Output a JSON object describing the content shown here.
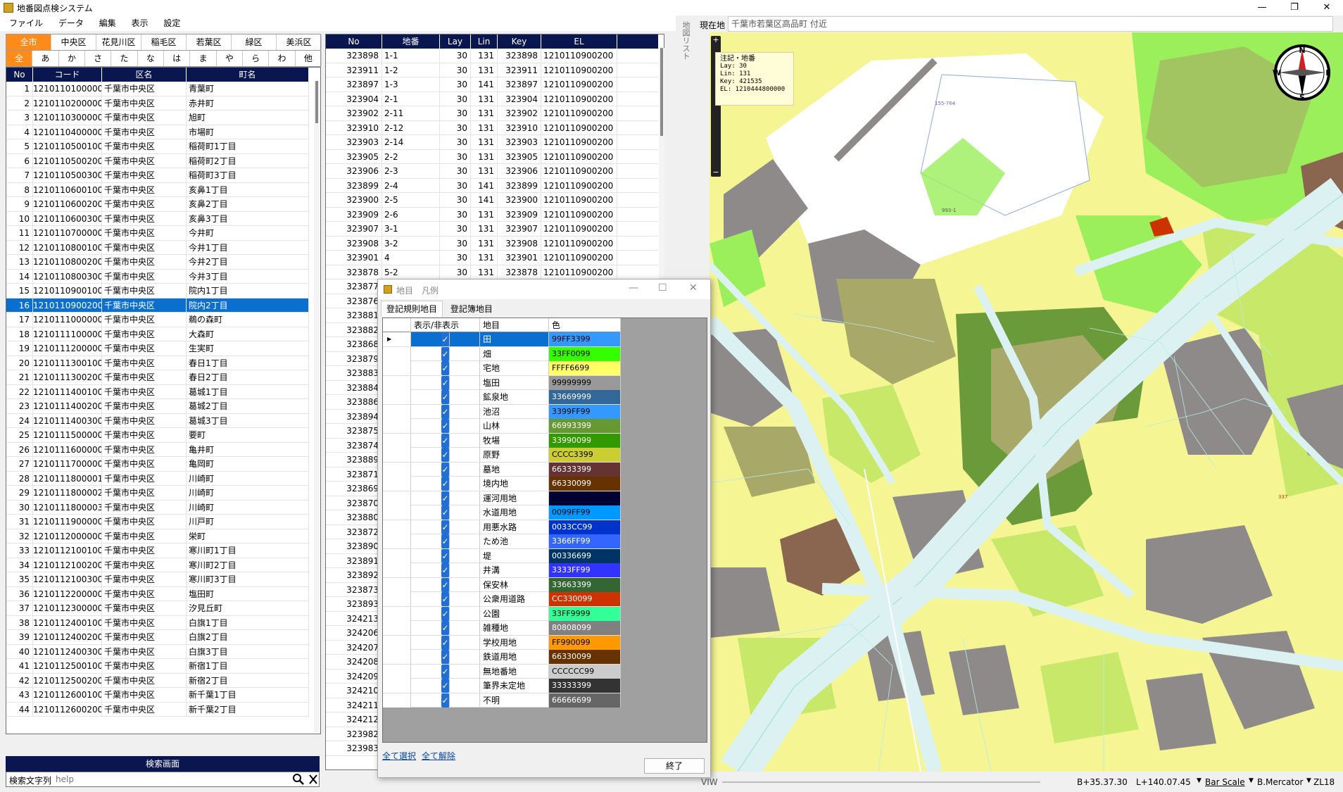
{
  "window": {
    "title": "地番図点検システム",
    "controls": [
      "—",
      "❐",
      "✕"
    ]
  },
  "menu": [
    "ファイル",
    "データ",
    "編集",
    "表示",
    "設定"
  ],
  "ward_tabs": [
    "全市",
    "中央区",
    "花見川区",
    "稲毛区",
    "若葉区",
    "緑区",
    "美浜区"
  ],
  "kana_tabs": [
    "全",
    "あ",
    "か",
    "さ",
    "た",
    "な",
    "は",
    "ま",
    "や",
    "ら",
    "わ",
    "他"
  ],
  "town_table": {
    "columns": [
      "No",
      "コード",
      "区名",
      "町名"
    ],
    "selected_no": "16",
    "rows": [
      [
        "1",
        "1210110100000",
        "千葉市中央区",
        "青葉町"
      ],
      [
        "2",
        "1210110200000",
        "千葉市中央区",
        "赤井町"
      ],
      [
        "3",
        "1210110300000",
        "千葉市中央区",
        "旭町"
      ],
      [
        "4",
        "1210110400000",
        "千葉市中央区",
        "市場町"
      ],
      [
        "5",
        "1210110500100",
        "千葉市中央区",
        "稲荷町1丁目"
      ],
      [
        "6",
        "1210110500200",
        "千葉市中央区",
        "稲荷町2丁目"
      ],
      [
        "7",
        "1210110500300",
        "千葉市中央区",
        "稲荷町3丁目"
      ],
      [
        "8",
        "1210110600100",
        "千葉市中央区",
        "亥鼻1丁目"
      ],
      [
        "9",
        "1210110600200",
        "千葉市中央区",
        "亥鼻2丁目"
      ],
      [
        "10",
        "1210110600300",
        "千葉市中央区",
        "亥鼻3丁目"
      ],
      [
        "11",
        "1210110700000",
        "千葉市中央区",
        "今井町"
      ],
      [
        "12",
        "1210110800100",
        "千葉市中央区",
        "今井1丁目"
      ],
      [
        "13",
        "1210110800200",
        "千葉市中央区",
        "今井2丁目"
      ],
      [
        "14",
        "1210110800300",
        "千葉市中央区",
        "今井3丁目"
      ],
      [
        "15",
        "1210110900100",
        "千葉市中央区",
        "院内1丁目"
      ],
      [
        "16",
        "1210110900200",
        "千葉市中央区",
        "院内2丁目"
      ],
      [
        "17",
        "1210111000000",
        "千葉市中央区",
        "鵜の森町"
      ],
      [
        "18",
        "1210111100000",
        "千葉市中央区",
        "大森町"
      ],
      [
        "19",
        "1210111200000",
        "千葉市中央区",
        "生実町"
      ],
      [
        "20",
        "1210111300100",
        "千葉市中央区",
        "春日1丁目"
      ],
      [
        "21",
        "1210111300200",
        "千葉市中央区",
        "春日2丁目"
      ],
      [
        "22",
        "1210111400100",
        "千葉市中央区",
        "葛城1丁目"
      ],
      [
        "23",
        "1210111400200",
        "千葉市中央区",
        "葛城2丁目"
      ],
      [
        "24",
        "1210111400300",
        "千葉市中央区",
        "葛城3丁目"
      ],
      [
        "25",
        "1210111500000",
        "千葉市中央区",
        "要町"
      ],
      [
        "26",
        "1210111600000",
        "千葉市中央区",
        "亀井町"
      ],
      [
        "27",
        "1210111700000",
        "千葉市中央区",
        "亀岡町"
      ],
      [
        "28",
        "1210111800001",
        "千葉市中央区",
        "川崎町"
      ],
      [
        "29",
        "1210111800002",
        "千葉市中央区",
        "川崎町"
      ],
      [
        "30",
        "1210111800003",
        "千葉市中央区",
        "川崎町"
      ],
      [
        "31",
        "1210111900000",
        "千葉市中央区",
        "川戸町"
      ],
      [
        "32",
        "1210112000000",
        "千葉市中央区",
        "栄町"
      ],
      [
        "33",
        "1210112100100",
        "千葉市中央区",
        "寒川町1丁目"
      ],
      [
        "34",
        "1210112100200",
        "千葉市中央区",
        "寒川町2丁目"
      ],
      [
        "35",
        "1210112100300",
        "千葉市中央区",
        "寒川町3丁目"
      ],
      [
        "36",
        "1210112200000",
        "千葉市中央区",
        "塩田町"
      ],
      [
        "37",
        "1210112300000",
        "千葉市中央区",
        "汐見丘町"
      ],
      [
        "38",
        "1210112400100",
        "千葉市中央区",
        "白旗1丁目"
      ],
      [
        "39",
        "1210112400200",
        "千葉市中央区",
        "白旗2丁目"
      ],
      [
        "40",
        "1210112400300",
        "千葉市中央区",
        "白旗3丁目"
      ],
      [
        "41",
        "1210112500100",
        "千葉市中央区",
        "新宿1丁目"
      ],
      [
        "42",
        "1210112500200",
        "千葉市中央区",
        "新宿2丁目"
      ],
      [
        "43",
        "1210112600100",
        "千葉市中央区",
        "新千葉1丁目"
      ],
      [
        "44",
        "1210112600200",
        "千葉市中央区",
        "新千葉2丁目"
      ]
    ]
  },
  "lot_table": {
    "columns": [
      "No",
      "地番",
      "Lay",
      "Lin",
      "Key",
      "EL"
    ],
    "rows": [
      [
        "323898",
        "1-1",
        "30",
        "131",
        "323898",
        "1210110900200"
      ],
      [
        "323911",
        "1-2",
        "30",
        "131",
        "323911",
        "1210110900200"
      ],
      [
        "323897",
        "1-3",
        "30",
        "141",
        "323897",
        "1210110900200"
      ],
      [
        "323904",
        "2-1",
        "30",
        "131",
        "323904",
        "1210110900200"
      ],
      [
        "323902",
        "2-11",
        "30",
        "131",
        "323902",
        "1210110900200"
      ],
      [
        "323910",
        "2-12",
        "30",
        "131",
        "323910",
        "1210110900200"
      ],
      [
        "323903",
        "2-14",
        "30",
        "131",
        "323903",
        "1210110900200"
      ],
      [
        "323905",
        "2-2",
        "30",
        "131",
        "323905",
        "1210110900200"
      ],
      [
        "323906",
        "2-3",
        "30",
        "131",
        "323906",
        "1210110900200"
      ],
      [
        "323899",
        "2-4",
        "30",
        "141",
        "323899",
        "1210110900200"
      ],
      [
        "323900",
        "2-5",
        "30",
        "141",
        "323900",
        "1210110900200"
      ],
      [
        "323909",
        "2-6",
        "30",
        "131",
        "323909",
        "1210110900200"
      ],
      [
        "323907",
        "3-1",
        "30",
        "131",
        "323907",
        "1210110900200"
      ],
      [
        "323908",
        "3-2",
        "30",
        "131",
        "323908",
        "1210110900200"
      ],
      [
        "323901",
        "4",
        "30",
        "131",
        "323901",
        "1210110900200"
      ],
      [
        "323878",
        "5-2",
        "30",
        "131",
        "323878",
        "1210110900200"
      ],
      [
        "323877"
      ],
      [
        "323876"
      ],
      [
        "323881"
      ],
      [
        "323882"
      ],
      [
        "323868"
      ],
      [
        "323879"
      ],
      [
        "323883"
      ],
      [
        "323884"
      ],
      [
        "323886"
      ],
      [
        "323894"
      ],
      [
        "323875"
      ],
      [
        "323874"
      ],
      [
        "323889"
      ],
      [
        "323871"
      ],
      [
        "323869"
      ],
      [
        "323870"
      ],
      [
        "323880"
      ],
      [
        "323872"
      ],
      [
        "323890"
      ],
      [
        "323891"
      ],
      [
        "323892"
      ],
      [
        "323873"
      ],
      [
        "323893"
      ],
      [
        "324213"
      ],
      [
        "324206"
      ],
      [
        "324207"
      ],
      [
        "324208"
      ],
      [
        "324209"
      ],
      [
        "324210"
      ],
      [
        "324211"
      ],
      [
        "324212"
      ],
      [
        "323982"
      ],
      [
        "323983"
      ]
    ]
  },
  "search": {
    "header": "検索画面",
    "label": "検索文字列",
    "placeholder": "help",
    "search_icon": "magnifier-icon",
    "clear_icon": "close-icon"
  },
  "side_tab": "地図リスト",
  "location": {
    "label": "現在地",
    "value": "千葉市若葉区高品町 付近"
  },
  "map": {
    "info_popup": [
      "注記・地番",
      "Lay: 30",
      "Lin: 131",
      "Key: 421535",
      "EL: 1210444800000"
    ],
    "compass": {
      "n": "N",
      "s": "S",
      "e": "E",
      "w": "W"
    },
    "zoom": {
      "plus": "+",
      "minus": "−"
    },
    "labels": [
      "155-764",
      "993-1",
      "337"
    ],
    "colors": {
      "base": "#f5f594",
      "field": "#9aef5a",
      "road": "#dcf2f2",
      "forest": "#6b9a3a",
      "grey": "#8e8a8a",
      "olive": "#a8a868",
      "brown": "#8a6650",
      "red": "#cc3300"
    }
  },
  "status": {
    "lat": "B+35.37.30",
    "lon": "L+140.07.45",
    "scale": "Bar Scale",
    "projection": "B.Mercator",
    "zoom": "ZL18",
    "viw": "VIW"
  },
  "legend_dialog": {
    "title": "地目　凡例",
    "tabs": [
      "登記規則地目",
      "登記簿地目"
    ],
    "columns": [
      "表示/非表示",
      "地目",
      "色"
    ],
    "rows": [
      {
        "name": "田",
        "code": "99FF3399",
        "color": "#3399ff",
        "dark": false
      },
      {
        "name": "畑",
        "code": "33FF0099",
        "color": "#33ff00",
        "dark": false
      },
      {
        "name": "宅地",
        "code": "FFFF6699",
        "color": "#ffff66",
        "dark": false
      },
      {
        "name": "塩田",
        "code": "99999999",
        "color": "#999999",
        "dark": false
      },
      {
        "name": "鉱泉地",
        "code": "33669999",
        "color": "#336699",
        "dark": false
      },
      {
        "name": "池沼",
        "code": "3399FF99",
        "color": "#3399ff",
        "dark": false
      },
      {
        "name": "山林",
        "code": "66993399",
        "color": "#669933",
        "dark": false
      },
      {
        "name": "牧場",
        "code": "33990099",
        "color": "#339900",
        "dark": false
      },
      {
        "name": "原野",
        "code": "CCCC3399",
        "color": "#cccc33",
        "dark": false
      },
      {
        "name": "墓地",
        "code": "66333399",
        "color": "#663333",
        "dark": false
      },
      {
        "name": "境内地",
        "code": "66330099",
        "color": "#663300",
        "dark": false
      },
      {
        "name": "運河用地",
        "code": "",
        "color": "#000033",
        "dark": true
      },
      {
        "name": "水道用地",
        "code": "0099FF99",
        "color": "#0099ff",
        "dark": false
      },
      {
        "name": "用悪水路",
        "code": "0033CC99",
        "color": "#0033cc",
        "dark": false
      },
      {
        "name": "ため池",
        "code": "3366FF99",
        "color": "#3366ff",
        "dark": false
      },
      {
        "name": "堤",
        "code": "00336699",
        "color": "#003366",
        "dark": false
      },
      {
        "name": "井溝",
        "code": "3333FF99",
        "color": "#3333ff",
        "dark": false
      },
      {
        "name": "保安林",
        "code": "33663399",
        "color": "#336633",
        "dark": false
      },
      {
        "name": "公衆用道路",
        "code": "CC330099",
        "color": "#cc3300",
        "dark": false
      },
      {
        "name": "公園",
        "code": "33FF9999",
        "color": "#33ff99",
        "dark": false
      },
      {
        "name": "雑種地",
        "code": "80808099",
        "color": "#808080",
        "dark": false
      },
      {
        "name": "学校用地",
        "code": "FF990099",
        "color": "#ff9900",
        "dark": false
      },
      {
        "name": "鉄道用地",
        "code": "66330099",
        "color": "#663300",
        "dark": false
      },
      {
        "name": "無地番地",
        "code": "CCCCCC99",
        "color": "#cccccc",
        "dark": false
      },
      {
        "name": "筆界未定地",
        "code": "33333399",
        "color": "#333333",
        "dark": false
      },
      {
        "name": "不明",
        "code": "66666699",
        "color": "#666666",
        "dark": false
      }
    ],
    "select_all": "全て選択",
    "deselect_all": "全て解除",
    "close": "終了"
  }
}
